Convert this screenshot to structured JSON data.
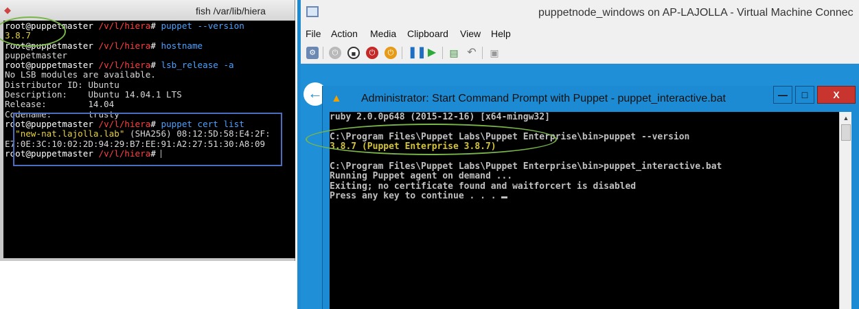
{
  "left_terminal": {
    "title": "fish  /var/lib/hiera",
    "lines": [
      [
        {
          "t": "root@puppetmaster ",
          "c": "p-user"
        },
        {
          "t": "/v/l/hiera",
          "c": "p-path"
        },
        {
          "t": "# ",
          "c": "p-hash"
        },
        {
          "t": "puppet --version",
          "c": "p-cmd"
        }
      ],
      [
        {
          "t": "3.8.7",
          "c": "p-ver"
        }
      ],
      [
        {
          "t": "root@puppetmaster ",
          "c": "p-user"
        },
        {
          "t": "/v/l/hiera",
          "c": "p-path"
        },
        {
          "t": "# ",
          "c": "p-hash"
        },
        {
          "t": "hostname",
          "c": "p-cmd"
        }
      ],
      [
        {
          "t": "puppetmaster",
          "c": "p-out"
        }
      ],
      [
        {
          "t": "root@puppetmaster ",
          "c": "p-user"
        },
        {
          "t": "/v/l/hiera",
          "c": "p-path"
        },
        {
          "t": "# ",
          "c": "p-hash"
        },
        {
          "t": "lsb_release -a",
          "c": "p-cmd"
        }
      ],
      [
        {
          "t": "No LSB modules are available.",
          "c": "p-out"
        }
      ],
      [
        {
          "t": "Distributor ID: Ubuntu",
          "c": "p-out"
        }
      ],
      [
        {
          "t": "Description:    Ubuntu 14.04.1 LTS",
          "c": "p-out"
        }
      ],
      [
        {
          "t": "Release:        14.04",
          "c": "p-out"
        }
      ],
      [
        {
          "t": "Codename:       trusty",
          "c": "p-out"
        }
      ],
      [
        {
          "t": "root@puppetmaster ",
          "c": "p-user"
        },
        {
          "t": "/v/l/hiera",
          "c": "p-path"
        },
        {
          "t": "# ",
          "c": "p-hash"
        },
        {
          "t": "puppet cert list",
          "c": "p-cmd"
        }
      ],
      [
        {
          "t": "  ",
          "c": "p-out"
        },
        {
          "t": "\"new-nat.lajolla.lab\"",
          "c": "p-str"
        },
        {
          "t": " (SHA256) 08:12:5D:58:E4:2F:",
          "c": "p-out"
        }
      ],
      [
        {
          "t": "E7:0E:3C:10:02:2D:94:29:B7:EE:91:A2:27:51:30:A8:09",
          "c": "p-out"
        }
      ],
      [
        {
          "t": "root@puppetmaster ",
          "c": "p-user"
        },
        {
          "t": "/v/l/hiera",
          "c": "p-path"
        },
        {
          "t": "# ",
          "c": "p-hash"
        }
      ]
    ]
  },
  "vm_window": {
    "title": "puppetnode_windows on AP-LAJOLLA - Virtual Machine Connec",
    "menu": [
      "File",
      "Action",
      "Media",
      "Clipboard",
      "View",
      "Help"
    ]
  },
  "cmd_window": {
    "title": "Administrator: Start Command Prompt with Puppet - puppet_interactive.bat",
    "minimize_glyph": "—",
    "maximize_glyph": "□",
    "close_glyph": "X",
    "lines": [
      [
        {
          "t": "ruby 2.0.0p648 (2015-12-16) [x64-mingw32]",
          "c": ""
        }
      ],
      [
        {
          "t": "",
          "c": ""
        }
      ],
      [
        {
          "t": "C:\\Program Files\\Puppet Labs\\Puppet Enterprise\\bin>puppet --version",
          "c": ""
        }
      ],
      [
        {
          "t": "3.8.7 (Puppet Enterprise 3.8.7)",
          "c": "yellow"
        }
      ],
      [
        {
          "t": "",
          "c": ""
        }
      ],
      [
        {
          "t": "C:\\Program Files\\Puppet Labs\\Puppet Enterprise\\bin>puppet_interactive.bat",
          "c": ""
        }
      ],
      [
        {
          "t": "Running Puppet agent on demand ...",
          "c": ""
        }
      ],
      [
        {
          "t": "Exiting; no certificate found and waitforcert is disabled",
          "c": ""
        }
      ],
      [
        {
          "t": "Press any key to continue . . . ",
          "c": ""
        }
      ]
    ]
  },
  "colors": {
    "annotation_green": "#7ab648",
    "annotation_blue": "#4a6fc0",
    "vm_accent": "#1c8bd3",
    "close_red": "#c7352e"
  },
  "icons": [
    "app-icon",
    "vm-icon",
    "ctrl-alt-del-icon",
    "start-icon",
    "turn-off-icon",
    "shutdown-icon",
    "save-icon",
    "pause-icon",
    "resume-icon",
    "checkpoint-icon",
    "revert-icon",
    "enhanced-session-icon",
    "back-icon",
    "cmd-icon",
    "scroll-up-icon"
  ]
}
